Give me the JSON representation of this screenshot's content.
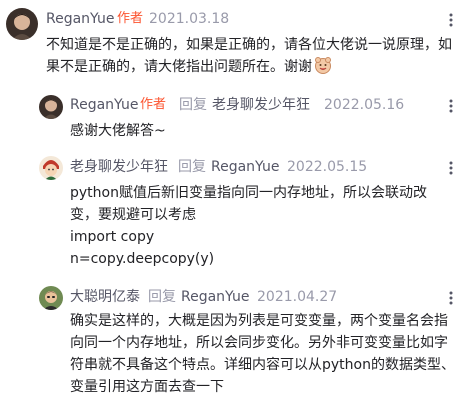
{
  "comments": [
    {
      "author": "ReganYue",
      "author_tag": "作者",
      "date": "2021.03.18",
      "text": "不知道是不是正确的，如果是正确的，请各位大佬说一说原理，如果不是正确的，请大佬指出问题所在。谢谢",
      "emoji_icon": "happy-emoji-icon"
    },
    {
      "author": "ReganYue",
      "author_tag": "作者",
      "reply_word": "回复",
      "reply_to": "老身聊发少年狂",
      "date": "2022.05.16",
      "text": "感谢大佬解答~"
    },
    {
      "author": "老身聊发少年狂",
      "reply_word": "回复",
      "reply_to": "ReganYue",
      "date": "2022.05.15",
      "text_lines": [
        "python赋值后新旧变量指向同一内存地址，所以会联动改变，要规避可以考虑",
        "import copy",
        "n=copy.deepcopy(y)"
      ]
    },
    {
      "author": "大聪明亿泰",
      "reply_word": "回复",
      "reply_to": "ReganYue",
      "date": "2021.04.27",
      "text": "确实是这样的，大概是因为列表是可变变量，两个变量名会指向同一个内存地址，所以会同步变化。另外非可变变量比如字符串就不具备这个特点。详细内容可以从python的数据类型、变量引用这方面去查一下"
    }
  ],
  "icons": {
    "more": "more-icon"
  },
  "colors": {
    "author_tag": "#fc5531",
    "name": "#555666",
    "meta": "#999aaa",
    "text": "#222226"
  }
}
